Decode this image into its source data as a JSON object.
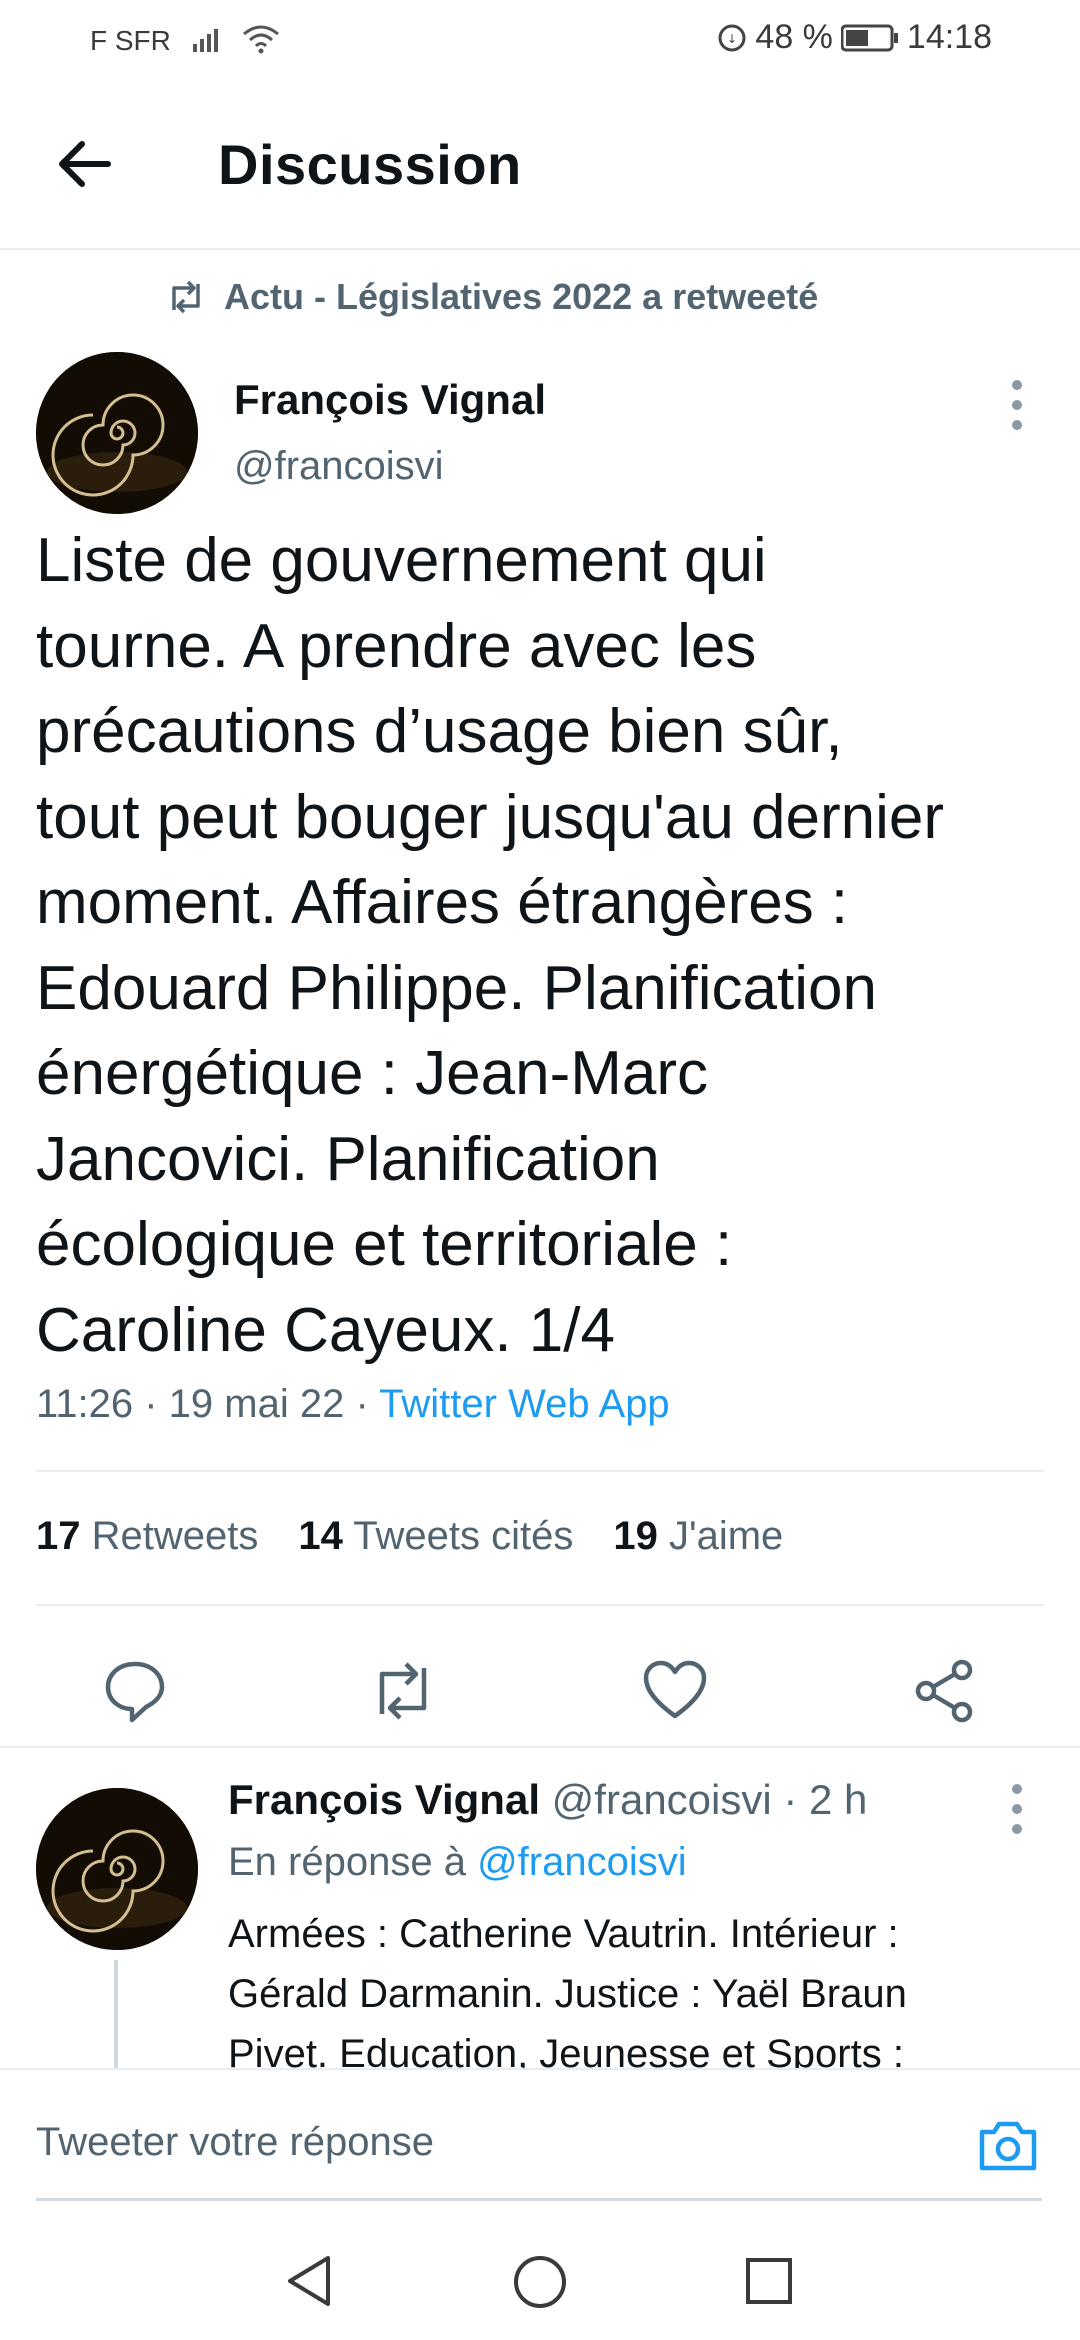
{
  "status_bar": {
    "carrier": "F SFR",
    "battery": "48 %",
    "time": "14:18"
  },
  "header": {
    "title": "Discussion"
  },
  "retweet_label": "Actu - Législatives 2022 a retweeté",
  "tweet": {
    "author_name": "François Vignal",
    "author_handle": "@francoisvi",
    "lines": [
      "Liste de gouvernement qui",
      "tourne. A prendre avec les",
      "précautions d’usage bien sûr,",
      "tout peut bouger jusqu'au dernier",
      "moment. Affaires étrangères :",
      "Edouard Philippe. Planification",
      "énergétique : Jean-Marc",
      "Jancovici. Planification",
      "écologique et territoriale :",
      "Caroline Cayeux.  1/4"
    ],
    "time_date": "11:26 · 19 mai 22 · ",
    "source": "Twitter Web App"
  },
  "stats": {
    "retweets_count": "17",
    "retweets_label": "Retweets",
    "quotes_count": "14",
    "quotes_label": "Tweets cités",
    "likes_count": "19",
    "likes_label": "J'aime"
  },
  "reply": {
    "author_name": "François Vignal",
    "author_handle": "@francoisvi",
    "age": "· 2 h",
    "reply_to_prefix": "En réponse à ",
    "reply_to_handle": "@francoisvi",
    "lines": [
      "Armées : Catherine Vautrin. Intérieur :",
      "Gérald Darmanin. Justice : Yaël Braun",
      "Pivet. Education, Jeunesse et Sports :"
    ]
  },
  "compose": {
    "placeholder": "Tweeter votre réponse"
  },
  "colors": {
    "accent": "#1d9bf0",
    "secondary_text": "#536471",
    "divider": "#e6ecf0"
  }
}
